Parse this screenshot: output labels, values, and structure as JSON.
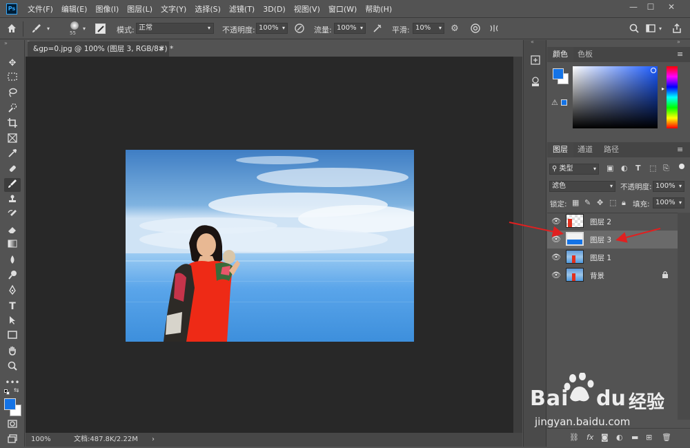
{
  "menubar": {
    "logo": "Ps",
    "items": [
      "文件(F)",
      "编辑(E)",
      "图像(I)",
      "图层(L)",
      "文字(Y)",
      "选择(S)",
      "滤镜(T)",
      "3D(D)",
      "视图(V)",
      "窗口(W)",
      "帮助(H)"
    ],
    "window_buttons": [
      "—",
      "☐",
      "✕"
    ]
  },
  "options": {
    "brush_size": "55",
    "mode_label": "模式:",
    "mode_value": "正常",
    "opacity_label": "不透明度:",
    "opacity_value": "100%",
    "flow_label": "流量:",
    "flow_value": "100%",
    "smooth_label": "平滑:",
    "smooth_value": "10%"
  },
  "document": {
    "tab_title": "&gp=0.jpg @ 100% (图层 3, RGB/8#) *",
    "tab_close": "×",
    "zoom": "100%",
    "doc_info": "文档:487.8K/2.22M",
    "status_arrow": "›"
  },
  "color_panel": {
    "tabs": [
      "颜色",
      "色板"
    ],
    "foreground": "#1473e6",
    "background": "#ffffff"
  },
  "layers_panel": {
    "tabs": [
      "图层",
      "通道",
      "路径"
    ],
    "filter_label": "类型",
    "blend_mode": "滤色",
    "opacity_label": "不透明度:",
    "opacity_value": "100%",
    "lock_label": "锁定:",
    "fill_label": "填充:",
    "fill_value": "100%",
    "layers": [
      {
        "name": "图层 2",
        "selected": false,
        "locked": false
      },
      {
        "name": "图层 3",
        "selected": true,
        "locked": false
      },
      {
        "name": "图层 1",
        "selected": false,
        "locked": false
      },
      {
        "name": "背景",
        "selected": false,
        "locked": true
      }
    ],
    "bottom_icons": [
      "link-icon",
      "fx-icon",
      "mask-icon",
      "adjustment-icon",
      "folder-icon",
      "new-layer-icon",
      "trash-icon"
    ]
  },
  "watermark": {
    "brand": "Bai",
    "brand2": "du",
    "chinese": "经验",
    "url": "jingyan.baidu.com"
  },
  "colors": {
    "accent": "#1473e6",
    "arrow": "#e02020"
  }
}
